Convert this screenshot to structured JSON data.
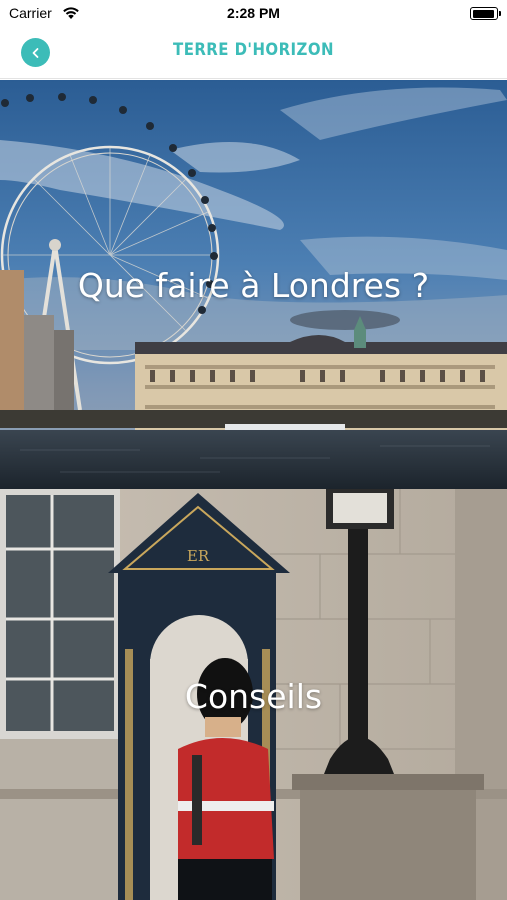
{
  "status_bar": {
    "carrier": "Carrier",
    "time": "2:28 PM",
    "icons": [
      "wifi-icon",
      "battery-icon"
    ]
  },
  "nav": {
    "title": "TERRE D'HORIZON",
    "back_icon": "chevron-left-icon",
    "accent_color": "#3cbcb8"
  },
  "cards": [
    {
      "title": "Que faire à Londres ?",
      "image": "london-eye-thames-photo"
    },
    {
      "title": "Conseils",
      "image": "queens-guard-sentry-box-photo"
    }
  ],
  "guard_box_monogram": "ER"
}
